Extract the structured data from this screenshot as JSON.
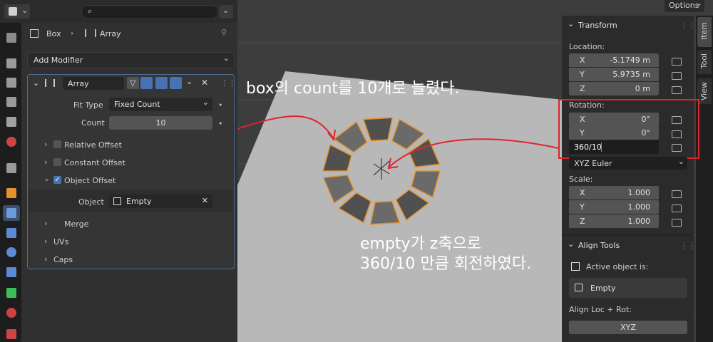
{
  "props_header": {
    "search_placeholder": ""
  },
  "breadcrumb": {
    "object": "Box",
    "modifier": "Array"
  },
  "add_modifier": "Add Modifier",
  "modifier": {
    "name": "Array",
    "fit_type_label": "Fit Type",
    "fit_type_value": "Fixed Count",
    "count_label": "Count",
    "count_value": "10",
    "relative_offset": "Relative Offset",
    "constant_offset": "Constant Offset",
    "object_offset": "Object Offset",
    "object_label": "Object",
    "object_value": "Empty",
    "merge": "Merge",
    "uvs": "UVs",
    "caps": "Caps"
  },
  "options_button": "Options",
  "transform": {
    "title": "Transform",
    "location_label": "Location:",
    "location": [
      {
        "axis": "X",
        "value": "-5.1749 m"
      },
      {
        "axis": "Y",
        "value": "5.9735 m"
      },
      {
        "axis": "Z",
        "value": "0 m"
      }
    ],
    "rotation_label": "Rotation:",
    "rotation": [
      {
        "axis": "X",
        "value": "0°"
      },
      {
        "axis": "Y",
        "value": "0°"
      }
    ],
    "rotation_z_input": "360/10",
    "rotation_mode": "XYZ Euler",
    "scale_label": "Scale:",
    "scale": [
      {
        "axis": "X",
        "value": "1.000"
      },
      {
        "axis": "Y",
        "value": "1.000"
      },
      {
        "axis": "Z",
        "value": "1.000"
      }
    ]
  },
  "align_tools": {
    "title": "Align Tools",
    "active_object_label": "Active object is:",
    "active_object": "Empty",
    "align_loc_rot": "Align Loc + Rot:",
    "xyz_button": "XYZ"
  },
  "sidebar_tabs": [
    "Item",
    "Tool",
    "View"
  ],
  "annotations": {
    "top": "box의 count를 10개로 늘렸다.",
    "bottom_line1": "empty가 z축으로",
    "bottom_line2": "360/10 만큼 회전하였다."
  },
  "colors": {
    "accent": "#4772b3",
    "annotation_red": "#e0242e",
    "object_orange": "#e8922a"
  }
}
